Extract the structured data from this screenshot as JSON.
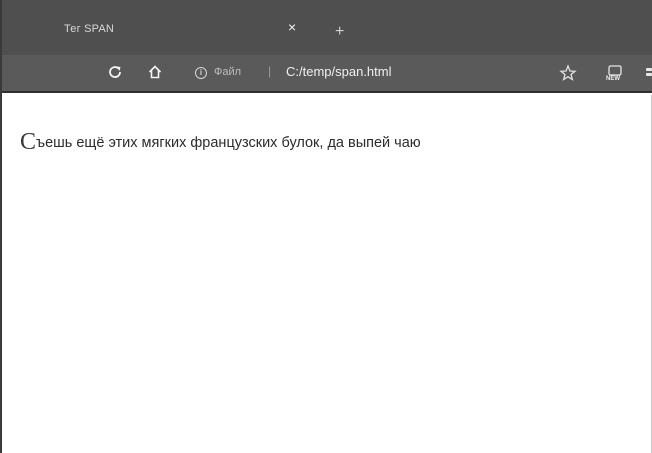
{
  "tab": {
    "title": "Тег SPAN",
    "close_glyph": "×",
    "new_tab_glyph": "+"
  },
  "toolbar": {
    "reload_icon": "reload-icon",
    "home_icon": "home-icon",
    "scheme_label": "Файл",
    "scheme_separator": "|",
    "address": "C:/temp/span.html",
    "extension_badge": "NEW"
  },
  "content": {
    "first_letter": "С",
    "rest_text": "ъешь ещё этих мягких французских булок, да выпей чаю"
  },
  "colors": {
    "tab_strip": "#4f4f4f",
    "toolbar": "#5a5a5a",
    "page_background": "#ffffff",
    "text": "#2c2c2c"
  }
}
